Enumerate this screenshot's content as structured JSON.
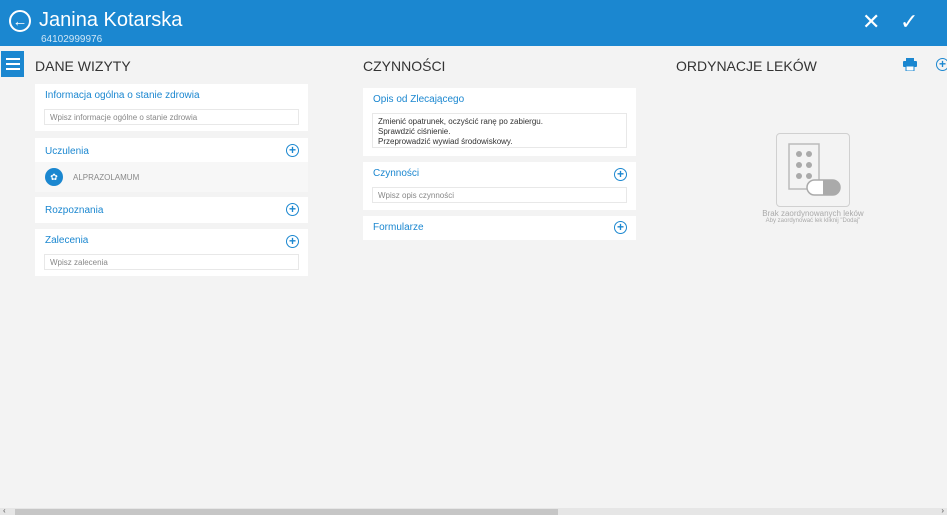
{
  "header": {
    "title": "Janina Kotarska",
    "subtitle": "64102999976",
    "back_icon": "arrow-left-circle",
    "close_icon": "close",
    "confirm_icon": "check"
  },
  "colors": {
    "accent": "#1b87d0",
    "background": "#f3f3f3"
  },
  "dane_wizyty": {
    "heading": "DANE WIZYTY",
    "info": {
      "title": "Informacja ogólna o stanie zdrowia",
      "placeholder": "Wpisz informacje ogólne o stanie zdrowia"
    },
    "uczulenia": {
      "title": "Uczulenia",
      "items": [
        {
          "name": "ALPRAZOLAMUM"
        }
      ]
    },
    "rozpoznania": {
      "title": "Rozpoznania"
    },
    "zalecenia": {
      "title": "Zalecenia",
      "placeholder": "Wpisz zalecenia"
    }
  },
  "czynnosci": {
    "heading": "CZYNNOŚCI",
    "opis": {
      "title": "Opis od Zlecającego",
      "lines": [
        "Zmienić opatrunek, oczyścić ranę po zabiergu.",
        "Sprawdzić ciśnienie.",
        "Przeprowadzić wywiad środowiskowy."
      ]
    },
    "czynnosci": {
      "title": "Czynności",
      "placeholder": "Wpisz opis czynności"
    },
    "formularze": {
      "title": "Formularze"
    }
  },
  "ordynacje": {
    "heading": "ORDYNACJE LEKÓW",
    "empty_title": "Brak zaordynowanych leków",
    "empty_hint": "Aby zaordynować lek kliknij \"Dodaj\""
  }
}
